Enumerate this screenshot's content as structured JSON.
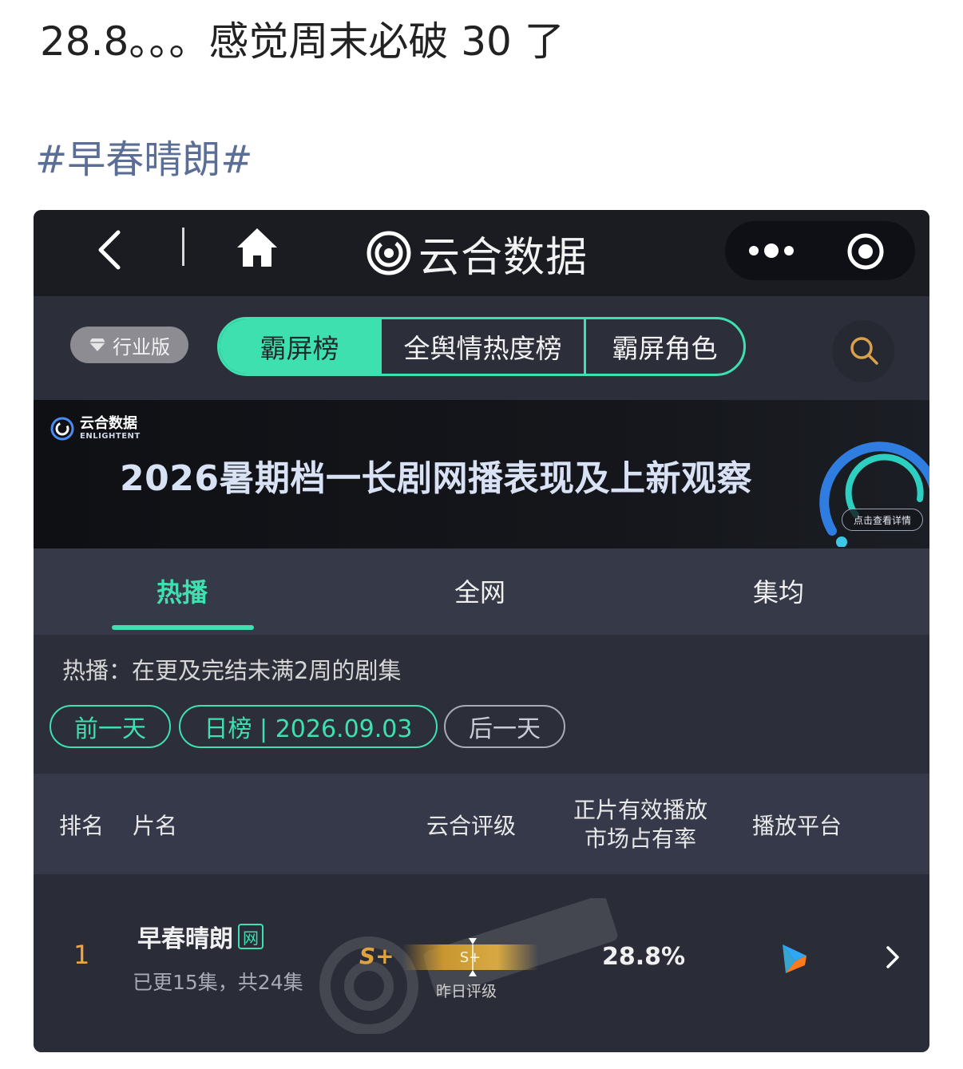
{
  "post": {
    "text": "28.8。。。感觉周末必破 30 了",
    "hashtag": "#早春晴朗#"
  },
  "app": {
    "title": "云合数据"
  },
  "filter": {
    "edition_label": "行业版",
    "segments": [
      "霸屏榜",
      "全舆情热度榜",
      "霸屏角色"
    ],
    "active_segment": "霸屏榜"
  },
  "banner": {
    "logo_cn": "云合数据",
    "logo_en": "ENLIGHTENT",
    "title": "2026暑期档一长剧网播表现及上新观察",
    "button": "点击查看详情"
  },
  "tabs": [
    {
      "label": "热播",
      "active": true
    },
    {
      "label": "全网",
      "active": false
    },
    {
      "label": "集均",
      "active": false
    }
  ],
  "info": {
    "description": "热播：在更及完结未满2周的剧集",
    "prev_label": "前一天",
    "date_label": "日榜 | 2026.09.03",
    "next_label": "后一天"
  },
  "table": {
    "headers": {
      "rank": "排名",
      "title": "片名",
      "grade": "云合评级",
      "share_line1": "正片有效播放",
      "share_line2": "市场占有率",
      "platform": "播放平台"
    },
    "rows": [
      {
        "rank": "1",
        "title": "早春晴朗",
        "badge": "网",
        "episodes": "已更15集，共24集",
        "grade": "S+",
        "grade_bar": "S+",
        "grade_caption": "昨日评级",
        "share": "28.8%",
        "platform": "youku-icon"
      }
    ]
  },
  "colors": {
    "accent": "#3ee0b0",
    "rank": "#f0a540",
    "grade": "#e0a23c",
    "hashtag": "#5b6e95"
  }
}
